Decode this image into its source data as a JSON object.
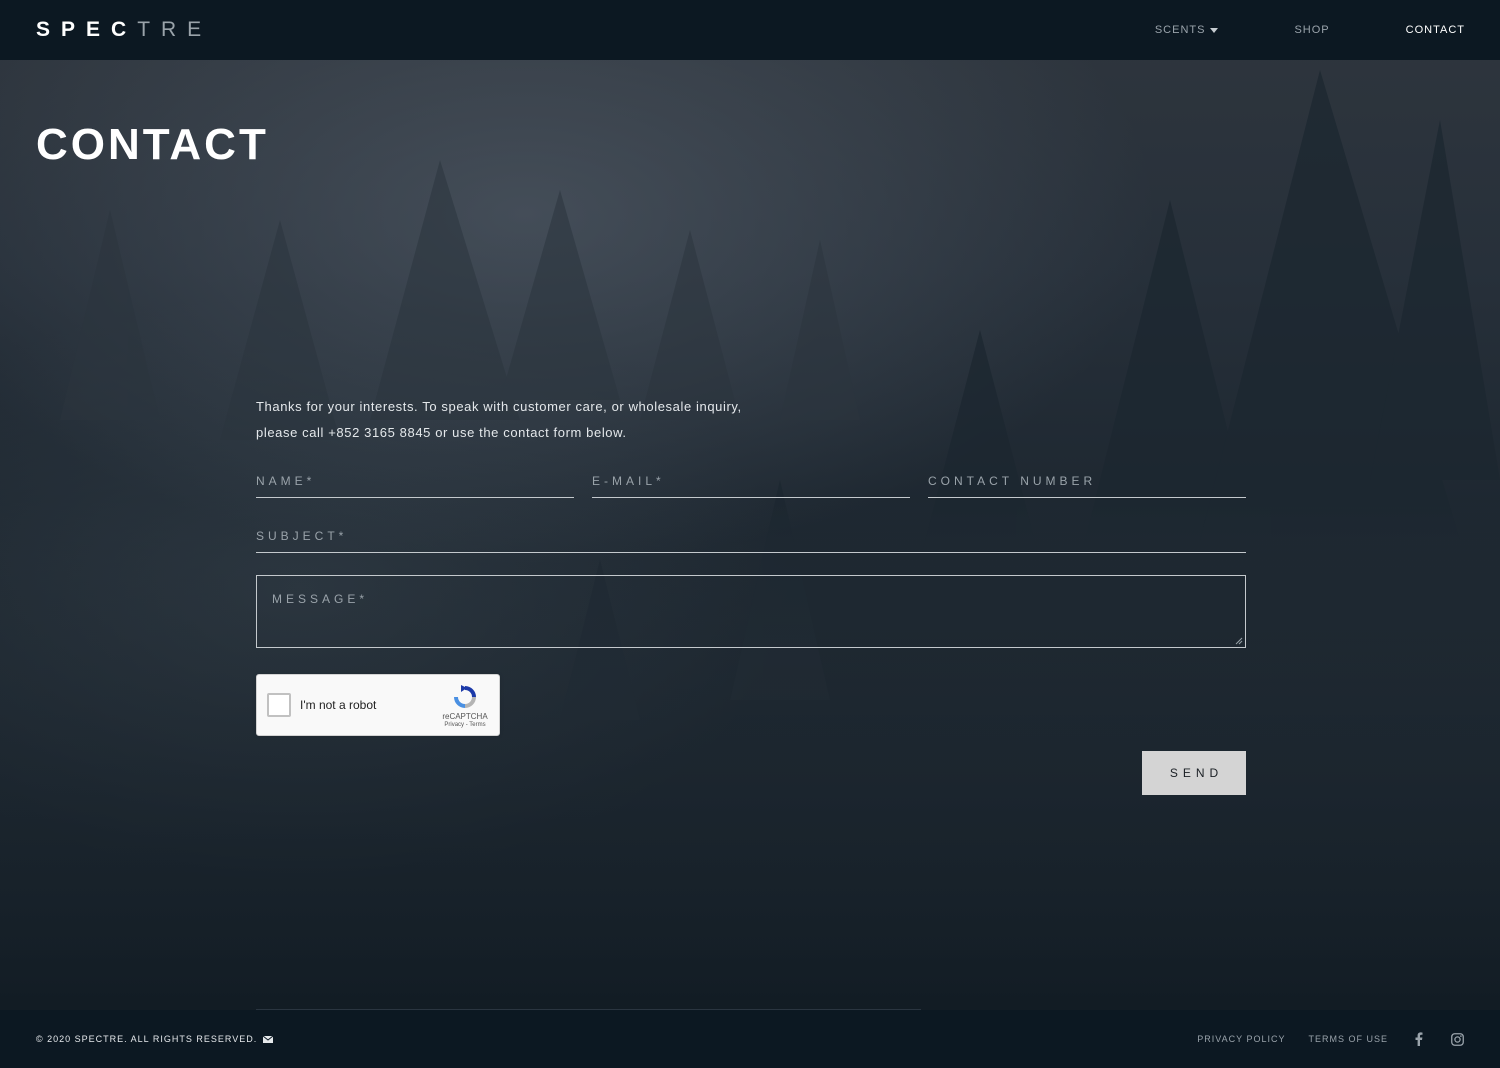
{
  "header": {
    "logo_bold": "SPEC",
    "logo_light": "TRE",
    "nav": [
      {
        "label": "SCENTS"
      },
      {
        "label": "SHOP"
      },
      {
        "label": "CONTACT"
      }
    ]
  },
  "page": {
    "title": "CONTACT",
    "intro_line1": "Thanks for your interests. To speak with customer care, or wholesale inquiry,",
    "intro_line2": "please call +852 3165 8845 or use the contact form below."
  },
  "form": {
    "name_placeholder": "NAME*",
    "email_placeholder": "E-MAIL*",
    "phone_placeholder": "CONTACT NUMBER",
    "subject_placeholder": "SUBJECT*",
    "message_placeholder": "MESSAGE*",
    "send_label": "SEND"
  },
  "captcha": {
    "label": "I'm not a robot",
    "brand": "reCAPTCHA",
    "links": "Privacy - Terms"
  },
  "footer": {
    "copyright": "© 2020 SPECTRE. ALL RIGHTS RESERVED.",
    "privacy": "PRIVACY POLICY",
    "terms": "TERMS OF USE"
  },
  "icons": {
    "nav_dropdown": "caret-down-icon",
    "footer_mail": "mail-icon",
    "social": [
      "facebook-icon",
      "instagram-icon"
    ]
  },
  "colors": {
    "header_bg": "#0c1822",
    "send_bg": "#d4d4d4",
    "nav_inactive": "#9aa3ab"
  }
}
